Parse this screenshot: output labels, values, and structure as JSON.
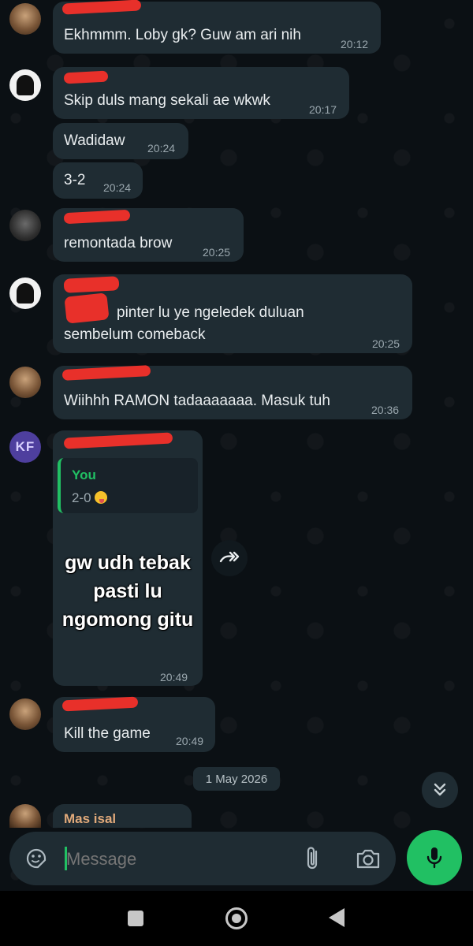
{
  "colors": {
    "background": "#0b1014",
    "bubble": "#1f2c33",
    "accent_green": "#21c063",
    "time_gray": "#9aa7ae",
    "redaction": "#e8302a",
    "kf_avatar": "#4e3f9e",
    "sender_mas_isal": "#e0a97a"
  },
  "messages": [
    {
      "text": "Ekhmmm. Loby gk? Guw am ari nih",
      "time": "20:12"
    },
    {
      "text": "Skip duls mang sekali ae wkwk",
      "time": "20:17"
    },
    {
      "text": "Wadidaw",
      "time": "20:24"
    },
    {
      "text": "3-2",
      "time": "20:24"
    },
    {
      "text": "remontada brow",
      "time": "20:25"
    },
    {
      "text_line1": "pinter lu ye ngeledek duluan",
      "text_line2": "sembelum comeback",
      "time": "20:25"
    },
    {
      "text": "Wiihhh RAMON tadaaaaaaa. Masuk tuh",
      "time": "20:36"
    },
    {
      "avatar_initials": "KF",
      "reply_name": "You",
      "reply_text": "2-0",
      "reply_emoji": "zany-face-emoji",
      "sticker_lines": [
        "gw udh tebak",
        "pasti lu",
        "ngomong gitu"
      ],
      "time": "20:49"
    },
    {
      "text": "Kill the game",
      "time": "20:49"
    },
    {
      "sender": "Mas isal"
    }
  ],
  "date_divider": "1 May 2026",
  "composer": {
    "placeholder": "Message",
    "icons": [
      "sticker-icon",
      "attach-icon",
      "camera-icon",
      "mic-icon"
    ]
  },
  "nav": {
    "icons": [
      "recents-icon",
      "home-icon",
      "back-icon"
    ]
  }
}
